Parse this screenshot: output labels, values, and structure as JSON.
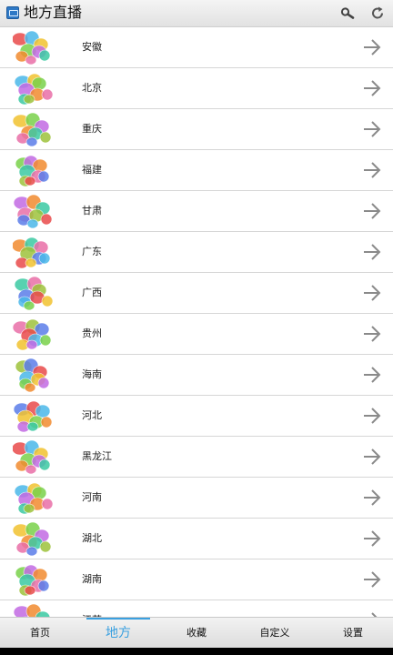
{
  "header": {
    "title": "地方直播",
    "search_icon": "search-icon",
    "refresh_icon": "refresh-icon"
  },
  "provinces": [
    {
      "label": "安徽",
      "map_icon": "anhui-map-icon"
    },
    {
      "label": "北京",
      "map_icon": "beijing-map-icon"
    },
    {
      "label": "重庆",
      "map_icon": "chongqing-map-icon"
    },
    {
      "label": "福建",
      "map_icon": "fujian-map-icon"
    },
    {
      "label": "甘肃",
      "map_icon": "gansu-map-icon"
    },
    {
      "label": "广东",
      "map_icon": "guangdong-map-icon"
    },
    {
      "label": "广西",
      "map_icon": "guangxi-map-icon"
    },
    {
      "label": "贵州",
      "map_icon": "guizhou-map-icon"
    },
    {
      "label": "海南",
      "map_icon": "hainan-map-icon"
    },
    {
      "label": "河北",
      "map_icon": "hebei-map-icon"
    },
    {
      "label": "黑龙江",
      "map_icon": "heilongjiang-map-icon"
    },
    {
      "label": "河南",
      "map_icon": "henan-map-icon"
    },
    {
      "label": "湖北",
      "map_icon": "hubei-map-icon"
    },
    {
      "label": "湖南",
      "map_icon": "hunan-map-icon"
    },
    {
      "label": "江苏",
      "map_icon": "jiangsu-map-icon"
    }
  ],
  "tabs": [
    {
      "label": "首页",
      "active": false
    },
    {
      "label": "地方",
      "active": true
    },
    {
      "label": "收藏",
      "active": false
    },
    {
      "label": "自定义",
      "active": false
    },
    {
      "label": "设置",
      "active": false
    }
  ],
  "colors": {
    "accent": "#3aa0e0",
    "divider": "#d6d6d6",
    "arrow": "#8a8a8a"
  }
}
